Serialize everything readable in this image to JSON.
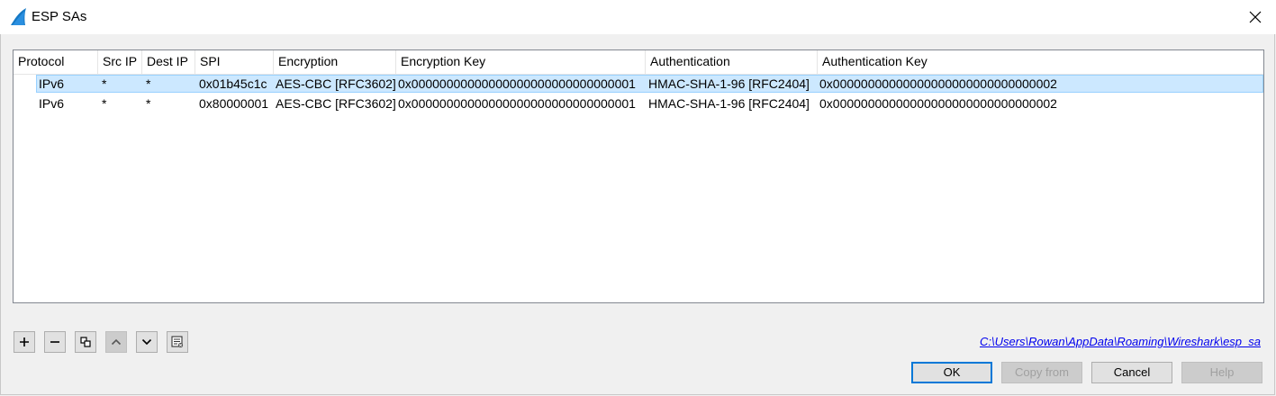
{
  "window": {
    "title": "ESP SAs",
    "close_glyph": "✕"
  },
  "table": {
    "columns": [
      "Protocol",
      "Src IP",
      "Dest IP",
      "SPI",
      "Encryption",
      "Encryption Key",
      "Authentication",
      "Authentication Key"
    ],
    "rows": [
      {
        "protocol": "IPv6",
        "src_ip": "*",
        "dest_ip": "*",
        "spi": "0x01b45c1c",
        "encryption": "AES-CBC [RFC3602]",
        "encryption_key": "0x00000000000000000000000000000001",
        "authentication": "HMAC-SHA-1-96 [RFC2404]",
        "authentication_key": "0x00000000000000000000000000000002",
        "selected": true
      },
      {
        "protocol": "IPv6",
        "src_ip": "*",
        "dest_ip": "*",
        "spi": "0x80000001",
        "encryption": "AES-CBC [RFC3602]",
        "encryption_key": "0x00000000000000000000000000000001",
        "authentication": "HMAC-SHA-1-96 [RFC2404]",
        "authentication_key": "0x00000000000000000000000000000002",
        "selected": false
      }
    ]
  },
  "toolbar": {
    "icons": [
      "plus-icon",
      "minus-icon",
      "copy-icon",
      "arrow-up-icon",
      "arrow-down-icon",
      "clear-icon"
    ]
  },
  "file_path": "C:\\Users\\Rowan\\AppData\\Roaming\\Wireshark\\esp_sa",
  "buttons": {
    "ok": "OK",
    "copy_from": "Copy from",
    "cancel": "Cancel",
    "help": "Help"
  },
  "colors": {
    "selection_bg": "#cce8ff",
    "selection_border": "#99d1ff",
    "default_button_border": "#0078d7",
    "link": "#0000ee"
  }
}
